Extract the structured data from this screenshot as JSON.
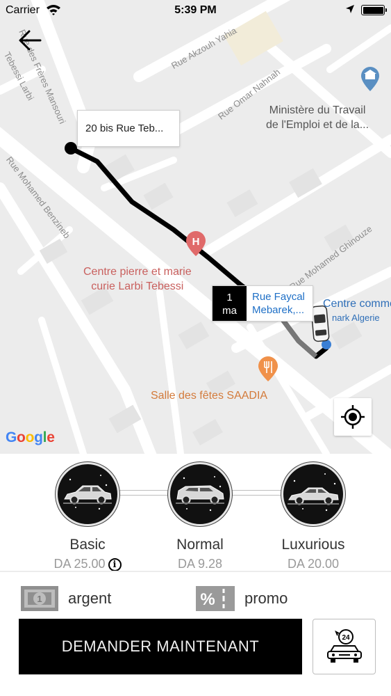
{
  "status_bar": {
    "carrier": "Carrier",
    "time": "5:39 PM",
    "wifi_icon": "wifi-icon",
    "location_icon": "location-arrow-icon",
    "battery_icon": "battery-icon"
  },
  "map": {
    "back_icon": "arrow-left-icon",
    "streets": [
      "Rue Akzouh Yahia",
      "Rue Omar Nahnah",
      "Rue des Frères Mansouri",
      "Tebessi Larbi",
      "Rue Mohamed Benzineb",
      "Rue Mohamed Ghinouze"
    ],
    "pois": {
      "ministry": "Ministère du Travail\nde l'Emploi et de la...",
      "hospital": "Centre pierre et marie\ncurie Larbi Tebessi",
      "venue": "Salle des fêtes SAADIA",
      "commerce": "Centre comme",
      "commerce_sub": "nark Algerie"
    },
    "origin_callout": "20 bis Rue Teb...",
    "destination_callout": {
      "eta_value": "1",
      "eta_unit": "ma",
      "name_line1": "Rue Faycal",
      "name_line2": "Mebarek,..."
    },
    "locate_icon": "crosshair-icon",
    "google_logo": "Google",
    "colors": {
      "route": "#000000",
      "hospital": "#d9534f",
      "venue": "#e0823a",
      "destination_link": "#1e6fc6"
    }
  },
  "vehicles": [
    {
      "name": "Basic",
      "price": "DA 25.00",
      "icon": "car-icon",
      "has_info": true
    },
    {
      "name": "Normal",
      "price": "DA 9.28",
      "icon": "car-icon",
      "has_info": false
    },
    {
      "name": "Luxurious",
      "price": "DA 20.00",
      "icon": "car-icon",
      "has_info": false
    }
  ],
  "payment": {
    "cash_label": "argent",
    "cash_icon": "banknote-icon",
    "promo_label": "promo",
    "promo_icon": "percent-icon"
  },
  "actions": {
    "request_label": "DEMANDER MAINTENANT",
    "schedule_icon": "scheduled-taxi-24-icon",
    "schedule_badge": "24"
  }
}
